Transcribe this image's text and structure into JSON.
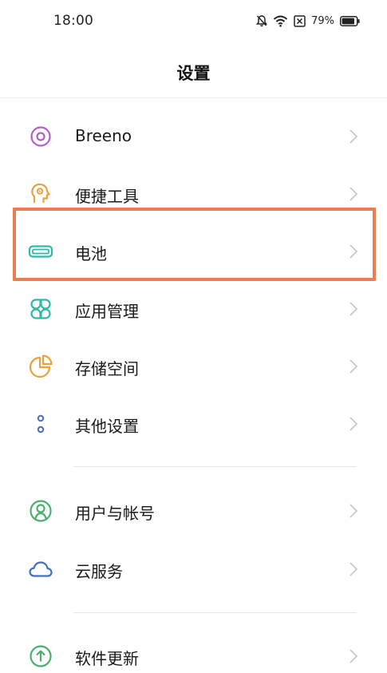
{
  "status_bar": {
    "time": "18:00",
    "battery_percent": "79%",
    "icons": [
      "bell-off-icon",
      "wifi-icon",
      "no-sim-icon",
      "battery-icon"
    ]
  },
  "header": {
    "title": "设置"
  },
  "settings": [
    {
      "label": "Breeno",
      "icon": "breeno-icon",
      "color": "#B65EC9"
    },
    {
      "label": "便捷工具",
      "icon": "convenience-tools-icon",
      "color": "#EBA23A"
    },
    {
      "label": "电池",
      "icon": "battery-icon",
      "color": "#2FB9A4"
    },
    {
      "label": "应用管理",
      "icon": "apps-grid-icon",
      "color": "#2FB9A4"
    },
    {
      "label": "存储空间",
      "icon": "storage-pie-icon",
      "color": "#EBA23A"
    },
    {
      "label": "其他设置",
      "icon": "more-settings-icon",
      "color": "#4F6FB0"
    },
    {
      "label": "用户与帐号",
      "icon": "user-account-icon",
      "color": "#4CAF6E"
    },
    {
      "label": "云服务",
      "icon": "cloud-icon",
      "color": "#3F6FC6"
    },
    {
      "label": "软件更新",
      "icon": "update-arrow-icon",
      "color": "#4CAF6E"
    }
  ],
  "highlight_color": "#E8804F"
}
